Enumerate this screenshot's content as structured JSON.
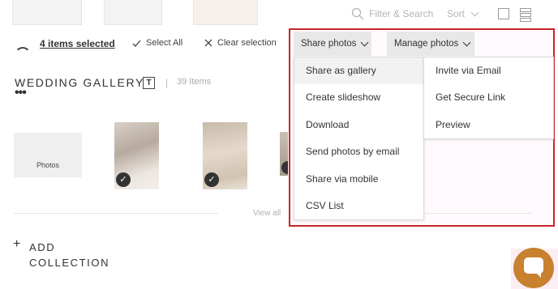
{
  "toolbar": {
    "search_placeholder": "Filter & Search",
    "sort_label": "Sort"
  },
  "selection": {
    "items_selected": "4 items selected",
    "select_all": "Select All",
    "clear_selection": "Clear selection"
  },
  "gallery": {
    "title": "WEDDING GALLERY",
    "type_icon_letter": "T",
    "separator": "|",
    "item_count": "39 Items",
    "photos_card_label": "Photos",
    "view_all": "View all"
  },
  "collection": {
    "plus": "+",
    "line1": "ADD",
    "line2": "COLLECTION"
  },
  "share_menu": {
    "tab_label": "Share photos",
    "items": [
      "Share as gallery",
      "Create slideshow",
      "Download",
      "Send photos by email",
      "Share via mobile",
      "CSV List"
    ],
    "hovered_index": 0
  },
  "manage_menu": {
    "tab_label": "Manage photos",
    "items": [
      "Invite via Email",
      "Get Secure Link",
      "Preview"
    ]
  },
  "colors": {
    "highlight_border": "#c8262b",
    "chat_button": "#c8812f"
  }
}
